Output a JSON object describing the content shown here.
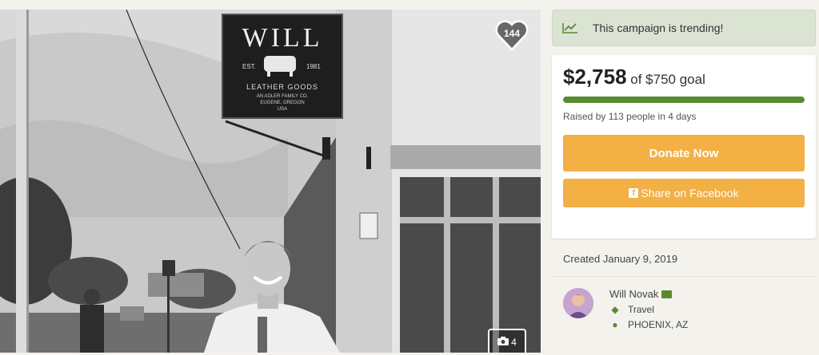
{
  "photo": {
    "like_count": "144",
    "photo_count": "4",
    "sign": {
      "name": "WILL",
      "est": "EST.",
      "year": "1981",
      "line1": "LEATHER GOODS",
      "line2": "AN ADLER FAMILY CO.",
      "line3": "EUGENE, OREGON",
      "line4": "USA"
    }
  },
  "trending": {
    "text": "This campaign is trending!",
    "icon": "trending-up-icon"
  },
  "funding": {
    "raised": "$2,758",
    "goal_text": "of $750 goal",
    "progress_fraction": 1.0,
    "raised_by": "Raised by 113 people in 4 days"
  },
  "buttons": {
    "donate": "Donate Now",
    "share": "Share on Facebook"
  },
  "created": "Created January 9, 2019",
  "organizer": {
    "name": "Will Novak",
    "category": "Travel",
    "location": "PHOENIX, AZ"
  },
  "colors": {
    "accent_green": "#5a8a2f",
    "button_orange": "#f2b045",
    "trending_bg": "#dbe3d3"
  }
}
